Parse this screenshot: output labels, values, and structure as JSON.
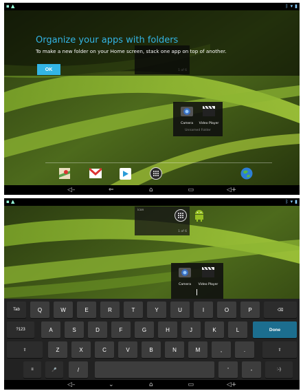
{
  "status_bar": {
    "right_icons": [
      "bluetooth-icon",
      "wifi-icon",
      "battery-icon"
    ]
  },
  "coach": {
    "title": "Organize your apps with folders",
    "text": "To make a new folder on your Home screen, stack one app on top of another.",
    "ok_label": "OK"
  },
  "widget": {
    "count": "1 of 6",
    "label": "icon"
  },
  "folder": {
    "apps": [
      {
        "label": "Camera",
        "icon": "camera-icon"
      },
      {
        "label": "Video Player",
        "icon": "video-player-icon"
      }
    ],
    "name": "Unnamed Folder"
  },
  "hotseat": [
    "maps-icon",
    "gmail-icon",
    "play-store-icon",
    "all-apps-icon",
    "browser-icon"
  ],
  "nav": {
    "back": "⇐",
    "home": "⌂",
    "recents": "▭",
    "volume_down": "◁–",
    "volume_up": "◁+",
    "rotate": "⟲"
  },
  "keyboard": {
    "row1": [
      "Tab",
      "Q",
      "W",
      "E",
      "R",
      "T",
      "Y",
      "U",
      "I",
      "O",
      "P",
      "⌫"
    ],
    "row2": [
      "?123",
      "A",
      "S",
      "D",
      "F",
      "G",
      "H",
      "J",
      "K",
      "L",
      "Done"
    ],
    "row3": [
      "⇧",
      "Z",
      "X",
      "C",
      "V",
      "B",
      "N",
      "M",
      ",",
      ".",
      "⇧"
    ],
    "row4": [
      "≡",
      "🎤",
      "/",
      "",
      "'",
      "-",
      ":-)"
    ]
  },
  "colors": {
    "accent": "#33b5e5",
    "done_key": "#1c6e8f",
    "keyboard_bg": "#222222"
  }
}
